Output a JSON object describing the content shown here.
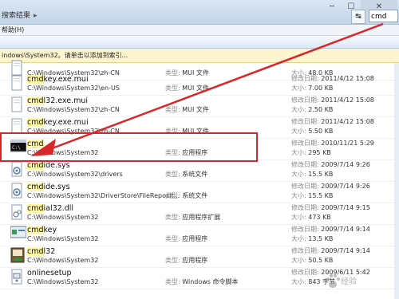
{
  "window": {
    "breadcrumb": "搜索结果",
    "breadcrumb_sep": "▸",
    "search_value": "cmd",
    "nav_arrow": "↹",
    "minimize": "─",
    "maximize": "☐",
    "close": "✕"
  },
  "menu": {
    "help": "帮助(H)"
  },
  "infobar": {
    "text": "indows\\System32。请单击以添加到索引..."
  },
  "labels": {
    "type": "类型: ",
    "modified": "修改日期: ",
    "size": "大小: "
  },
  "files": [
    {
      "name": "",
      "name_rest": "",
      "path": "C:\\Windows\\System32\\zh-CN",
      "type": "MUI 文件",
      "modified": "",
      "size": "48.0 KB",
      "icon": "mui-file-icon"
    },
    {
      "name": "cmdkey.exe.mui",
      "path": "C:\\Windows\\System32\\en-US",
      "type": "MUI 文件",
      "modified": "2011/4/12 15:08",
      "size": "7.00 KB",
      "icon": "mui-file-icon"
    },
    {
      "name": "cmdl32.exe.mui",
      "path": "C:\\Windows\\System32\\zh-CN",
      "type": "MUI 文件",
      "modified": "2011/4/12 15:08",
      "size": "2.50 KB",
      "icon": "mui-file-icon"
    },
    {
      "name": "cmdkey.exe.mui",
      "path": "C:\\Windows\\System32\\zh-CN",
      "type": "MUI 文件",
      "modified": "2011/4/12 15:08",
      "size": "5.50 KB",
      "icon": "mui-file-icon"
    },
    {
      "name": "cmd",
      "path": "C:\\Windows\\System32",
      "type": "应用程序",
      "modified": "2010/11/21 5:29",
      "size": "295 KB",
      "icon": "cmd-console-icon"
    },
    {
      "name": "cmdide.sys",
      "path": "C:\\Windows\\System32\\drivers",
      "type": "系统文件",
      "modified": "2009/7/14 9:26",
      "size": "15.5 KB",
      "icon": "sys-file-icon"
    },
    {
      "name": "cmdide.sys",
      "path": "C:\\Windows\\System32\\DriverStore\\FileReposit...",
      "type": "系统文件",
      "modified": "2009/7/14 9:26",
      "size": "15.5 KB",
      "icon": "sys-file-icon"
    },
    {
      "name": "cmdial32.dll",
      "path": "C:\\Windows\\System32",
      "type": "应用程序扩展",
      "modified": "2009/7/14 9:15",
      "size": "473 KB",
      "icon": "dll-file-icon"
    },
    {
      "name": "cmdkey",
      "path": "C:\\Windows\\System32",
      "type": "应用程序",
      "modified": "2009/7/14 9:14",
      "size": "13.5 KB",
      "icon": "cmdkey-app-icon"
    },
    {
      "name": "cmdl32",
      "path": "C:\\Windows\\System32",
      "type": "应用程序",
      "modified": "2009/7/14 9:14",
      "size": "50.5 KB",
      "icon": "cmdl32-app-icon"
    },
    {
      "name": "onlinesetup",
      "path": "C:\\Windows\\System32",
      "type": "Windows 命令脚本",
      "modified": "2009/6/11 5:42",
      "size": "843 字节",
      "icon": "script-file-icon"
    }
  ],
  "watermark": {
    "text": "经验"
  }
}
